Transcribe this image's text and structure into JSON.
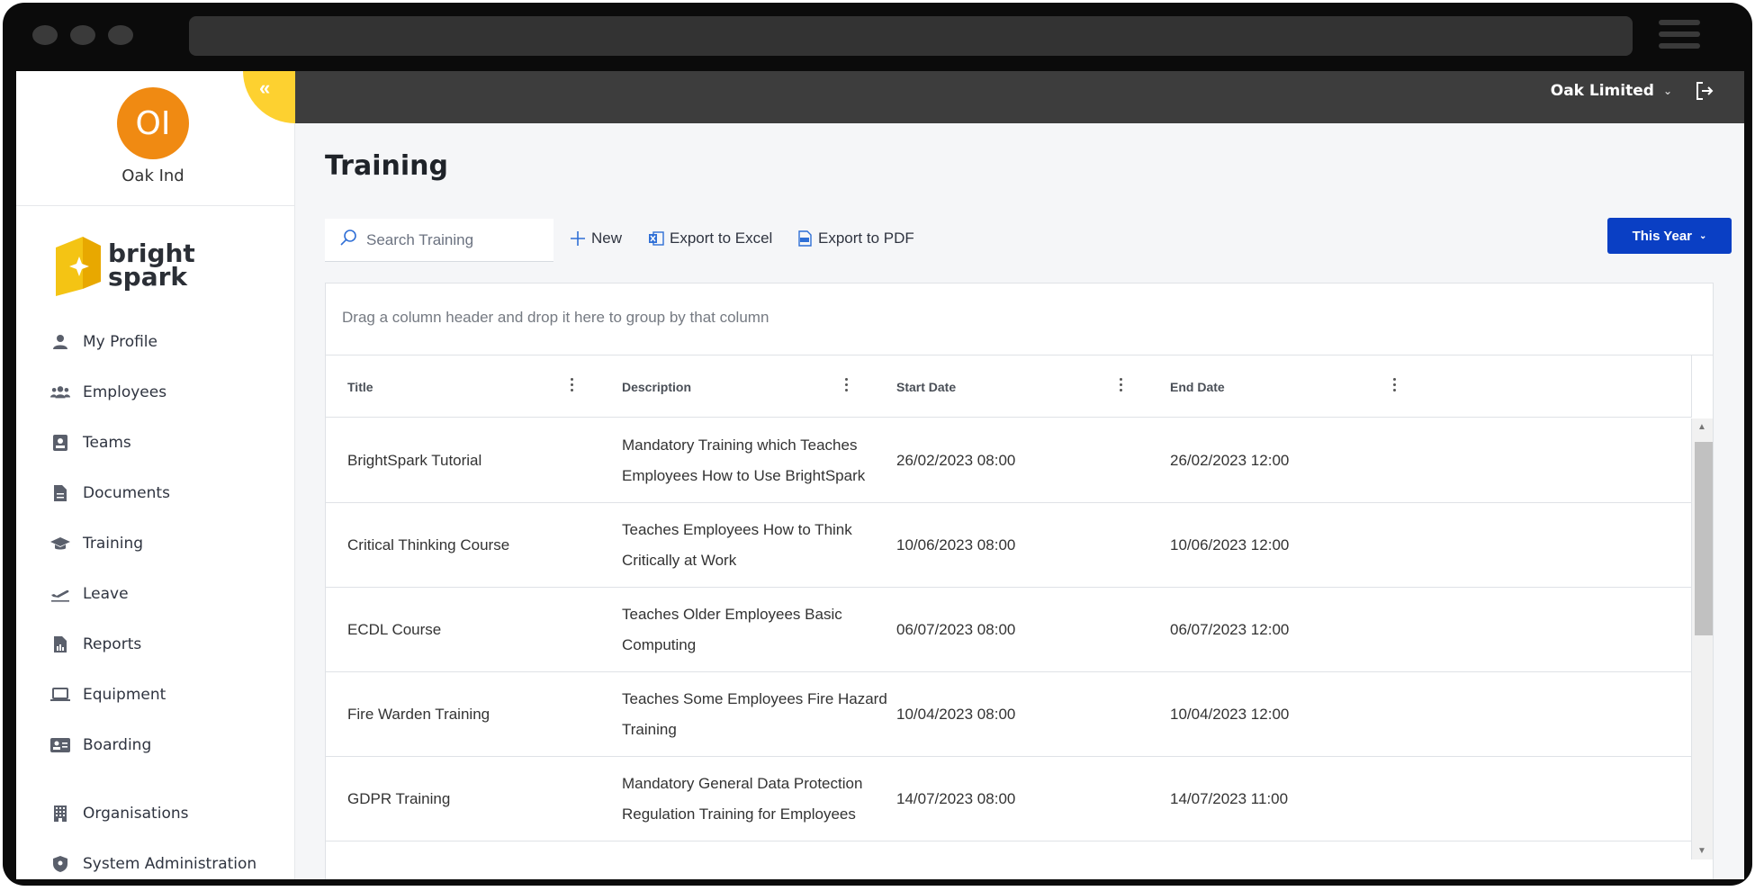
{
  "user": {
    "initials": "OI",
    "name": "Oak Ind"
  },
  "brand": {
    "line1": "bright",
    "line2": "spark"
  },
  "sidebar": {
    "items": [
      {
        "label": "My Profile",
        "icon": "user-icon"
      },
      {
        "label": "Employees",
        "icon": "users-icon"
      },
      {
        "label": "Teams",
        "icon": "id-card-icon"
      },
      {
        "label": "Documents",
        "icon": "document-icon"
      },
      {
        "label": "Training",
        "icon": "graduation-cap-icon"
      },
      {
        "label": "Leave",
        "icon": "plane-departure-icon"
      },
      {
        "label": "Reports",
        "icon": "report-icon"
      },
      {
        "label": "Equipment",
        "icon": "laptop-icon"
      },
      {
        "label": "Boarding",
        "icon": "address-card-icon"
      },
      {
        "label": "Organisations",
        "icon": "building-icon"
      },
      {
        "label": "System Administration",
        "icon": "shield-icon"
      }
    ]
  },
  "header": {
    "company": "Oak Limited"
  },
  "page": {
    "title": "Training"
  },
  "toolbar": {
    "search_placeholder": "Search Training",
    "new_label": "New",
    "excel_label": "Export to Excel",
    "pdf_label": "Export to PDF",
    "period_label": "This Year"
  },
  "grid": {
    "group_hint": "Drag a column header and drop it here to group by that column",
    "columns": [
      "Title",
      "Description",
      "Start Date",
      "End Date"
    ],
    "rows": [
      {
        "title": "BrightSpark Tutorial",
        "description": "Mandatory Training which Teaches Employees How to Use BrightSpark",
        "start": "26/02/2023 08:00",
        "end": "26/02/2023 12:00"
      },
      {
        "title": "Critical Thinking Course",
        "description": "Teaches Employees How to Think Critically at Work",
        "start": "10/06/2023 08:00",
        "end": "10/06/2023 12:00"
      },
      {
        "title": "ECDL Course",
        "description": "Teaches Older Employees Basic Computing",
        "start": "06/07/2023 08:00",
        "end": "06/07/2023 12:00"
      },
      {
        "title": "Fire Warden Training",
        "description": "Teaches Some Employees Fire Hazard Training",
        "start": "10/04/2023 08:00",
        "end": "10/04/2023 12:00"
      },
      {
        "title": "GDPR Training",
        "description": "Mandatory General Data Protection Regulation Training for Employees",
        "start": "14/07/2023 08:00",
        "end": "14/07/2023 11:00"
      }
    ]
  },
  "colors": {
    "accent": "#0a3fc4",
    "avatar": "#f08a12",
    "brand_yellow": "#fdd130",
    "topbar": "#3d3d3d"
  }
}
